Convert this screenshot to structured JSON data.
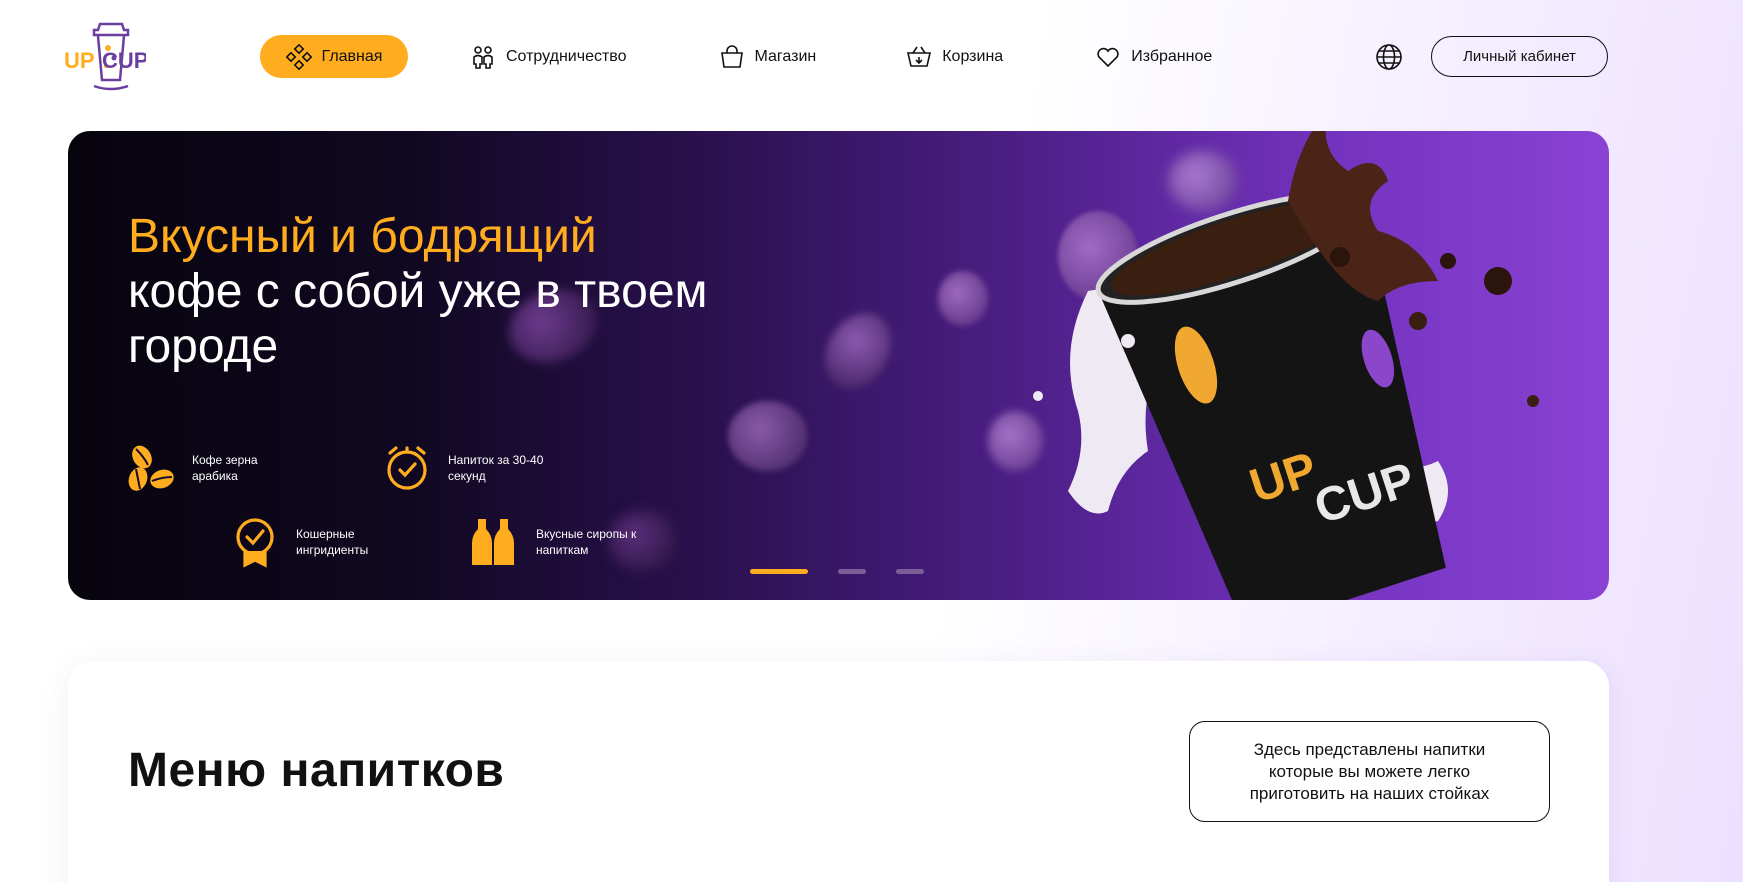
{
  "brand": {
    "logo_text_left": "UP",
    "logo_text_right": "CUP"
  },
  "nav": {
    "home": "Главная",
    "cooperation": "Сотрудничество",
    "shop": "Магазин",
    "cart": "Корзина",
    "favorites": "Избранное"
  },
  "header": {
    "cabinet_label": "Личный кабинет"
  },
  "hero": {
    "title_accent": "Вкусный и бодрящий",
    "title_rest": "кофе с собой уже в твоем городе",
    "features": [
      {
        "text": "Кофе зерна арабика",
        "icon": "coffee-beans-icon"
      },
      {
        "text": "Напиток за 30-40 секунд",
        "icon": "timer-check-icon"
      },
      {
        "text": "Кошерные ингридиенты",
        "icon": "quality-badge-icon"
      },
      {
        "text": "Вкусные сиропы к напиткам",
        "icon": "syrup-bottles-icon"
      }
    ],
    "slider": {
      "total": 3,
      "active": 1
    },
    "cup_logo_left": "UP",
    "cup_logo_right": "CUP"
  },
  "menu": {
    "title": "Меню напитков",
    "description": "Здесь представлены напитки которые вы можете легко приготовить на наших стойках"
  },
  "colors": {
    "accent": "#ffad1f",
    "purple": "#8a42d4",
    "dark": "#07040d"
  }
}
